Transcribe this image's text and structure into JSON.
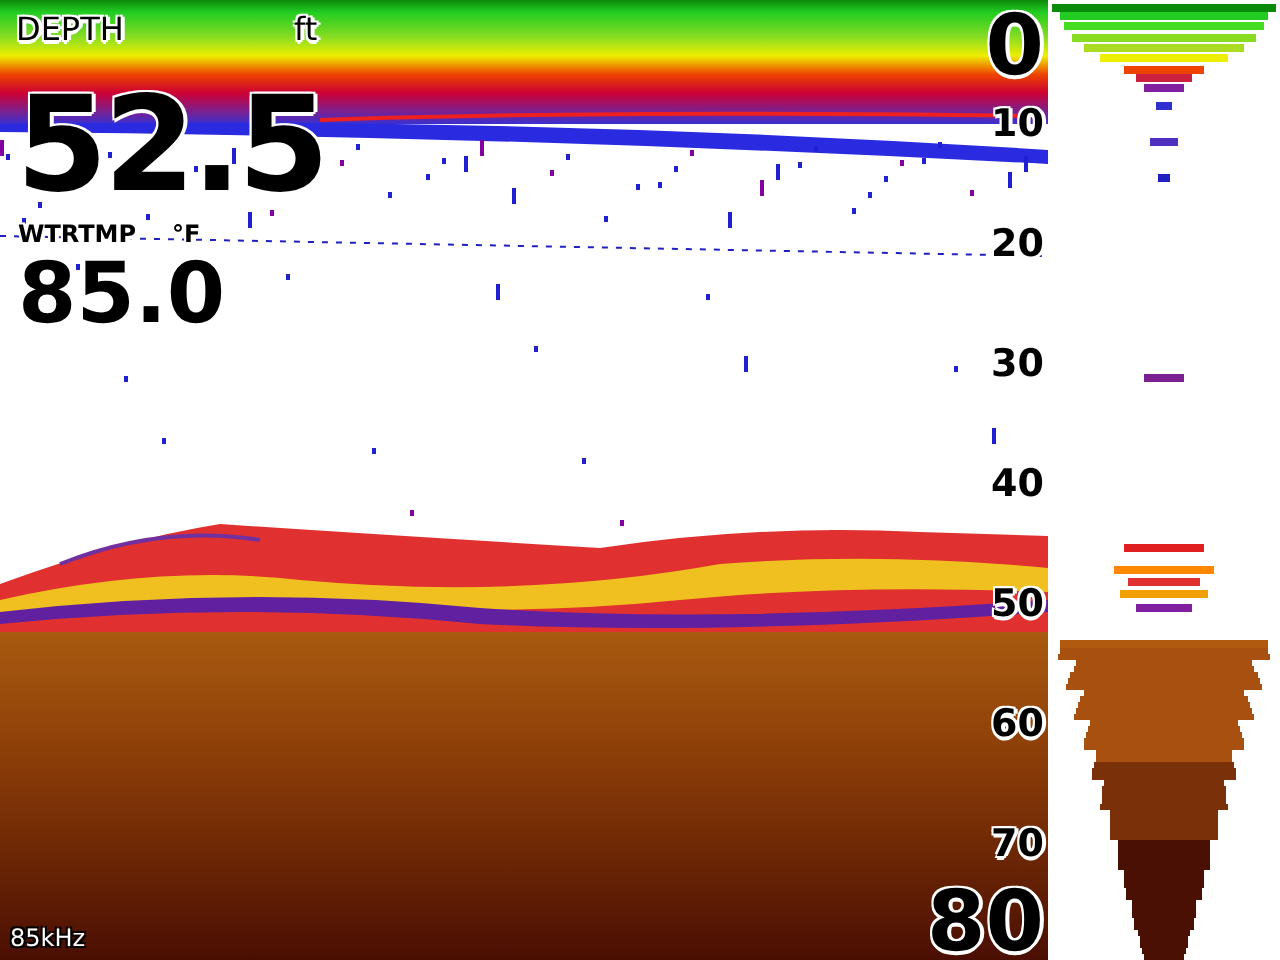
{
  "depth": {
    "label": "DEPTH",
    "unit": "ft",
    "value": "52.5"
  },
  "water_temp": {
    "label": "WTRTMP",
    "unit": "°F",
    "value": "85.0"
  },
  "depth_scale": [
    {
      "label": "0",
      "kind": "major"
    },
    {
      "label": "10",
      "kind": "minor"
    },
    {
      "label": "20",
      "kind": "minor"
    },
    {
      "label": "30",
      "kind": "minor"
    },
    {
      "label": "40",
      "kind": "minor"
    },
    {
      "label": "50",
      "kind": "minor"
    },
    {
      "label": "60",
      "kind": "minor"
    },
    {
      "label": "70",
      "kind": "minor"
    },
    {
      "label": "80",
      "kind": "major"
    }
  ],
  "frequency": "85kHz"
}
